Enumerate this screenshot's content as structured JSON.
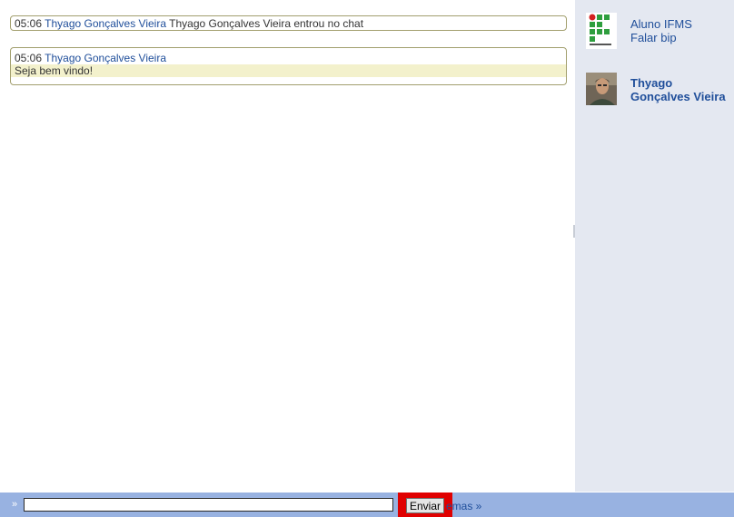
{
  "messages": [
    {
      "type": "system",
      "time": "05:06",
      "user": "Thyago Gonçalves Vieira",
      "text": "Thyago Gonçalves Vieira entrou no chat"
    },
    {
      "type": "user",
      "time": "05:06",
      "user": "Thyago Gonçalves Vieira",
      "text": "Seja bem vindo!"
    }
  ],
  "sidebar": {
    "participants": [
      {
        "avatar_icon": "ifms-logo-icon",
        "line1": "Aluno IFMS",
        "line2": "Falar bip"
      },
      {
        "avatar_icon": "user-photo-avatar",
        "name": "Thyago Gonçalves Vieira"
      }
    ]
  },
  "composer": {
    "prompt_symbol": "»",
    "input_value": "",
    "send_label": "Enviar",
    "themes_link": "emas »"
  },
  "colors": {
    "sidebar_bg": "#e4e8f1",
    "bottom_bar_bg": "#98b2e1",
    "link_blue": "#1f4e9a",
    "highlight_red": "#e00000",
    "message_body_bg": "#f3f1cc"
  }
}
